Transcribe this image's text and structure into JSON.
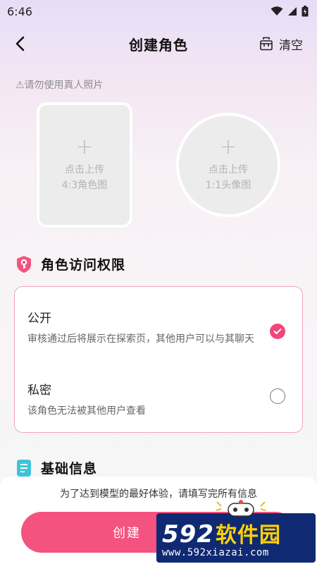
{
  "status_bar": {
    "time": "6:46"
  },
  "header": {
    "title": "创建角色",
    "clear_label": "清空"
  },
  "warning": {
    "text": "⚠请勿使用真人照片"
  },
  "uploads": {
    "role_image": {
      "line1": "点击上传",
      "line2": "4:3角色图"
    },
    "avatar_image": {
      "line1": "点击上传",
      "line2": "1:1头像图"
    }
  },
  "access_section": {
    "title": "角色访问权限",
    "options": [
      {
        "title": "公开",
        "desc": "审核通过后将展示在探索页，其他用户可以与其聊天",
        "selected": true
      },
      {
        "title": "私密",
        "desc": "该角色无法被其他用户查看",
        "selected": false
      }
    ]
  },
  "basic_section": {
    "title": "基础信息"
  },
  "footer": {
    "hint": "为了达到模型的最好体验，请填写完所有信息",
    "create_label": "创建"
  },
  "watermark": {
    "numbers": "592",
    "brand": "软件园",
    "url": "www.592xiazai.com"
  },
  "colors": {
    "accent": "#f4527f",
    "checked": "#f1467a",
    "card_border": "#f3a4bb"
  },
  "icons": [
    "wifi-icon",
    "signal-icon",
    "battery-icon",
    "back-arrow-icon",
    "clear-icon",
    "plus-icon",
    "shield-key-icon",
    "check-icon",
    "document-icon"
  ]
}
